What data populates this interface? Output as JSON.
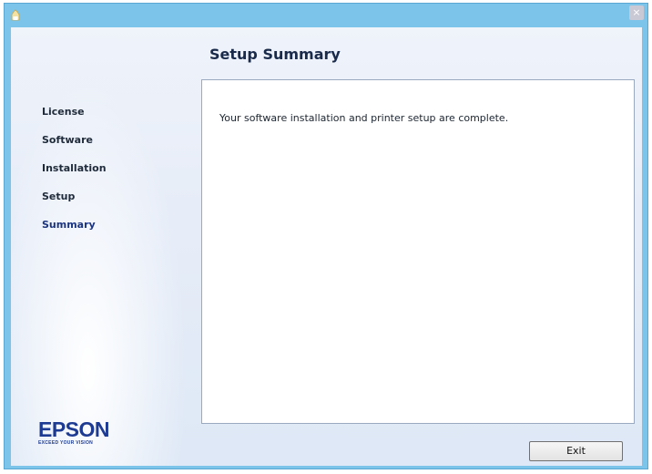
{
  "window": {
    "close_glyph": "×"
  },
  "header": {
    "title": "Setup Summary"
  },
  "sidebar": {
    "steps": [
      {
        "label": "License",
        "active": false
      },
      {
        "label": "Software",
        "active": false
      },
      {
        "label": "Installation",
        "active": false
      },
      {
        "label": "Setup",
        "active": false
      },
      {
        "label": "Summary",
        "active": true
      }
    ]
  },
  "main": {
    "message": "Your software installation and printer setup are complete."
  },
  "brand": {
    "name": "EPSON",
    "tagline": "EXCEED YOUR VISION",
    "color": "#1d3b93"
  },
  "footer": {
    "exit_label": "Exit"
  },
  "colors": {
    "window_frame": "#7dc4ea",
    "active_step": "#1b3480"
  }
}
